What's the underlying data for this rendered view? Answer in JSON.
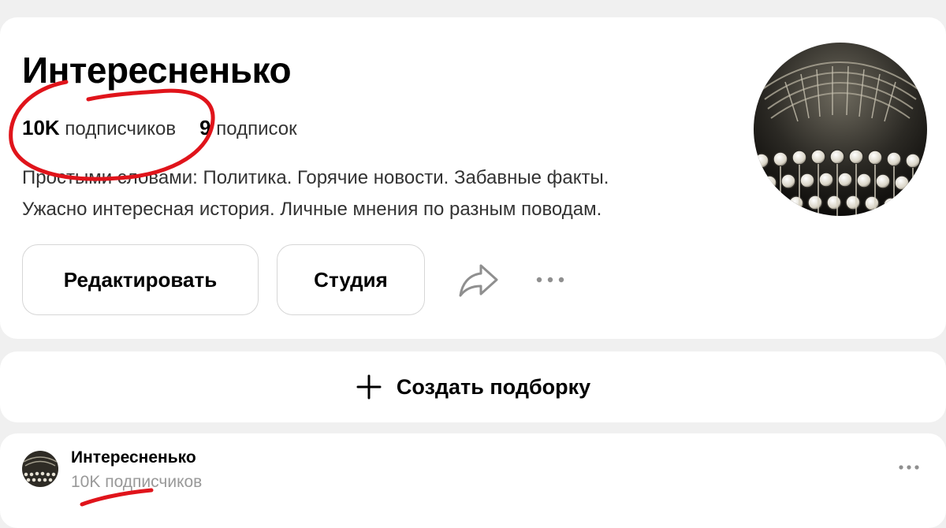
{
  "profile": {
    "title": "Интересненько",
    "followers_count": "10K",
    "followers_label": "подписчиков",
    "following_count": "9",
    "following_label": "подписок",
    "description_line1": "Простыми словами: Политика. Горячие новости. Забавные факты.",
    "description_line2": "Ужасно интересная история. Личные мнения по разным поводам.",
    "edit_button": "Редактировать",
    "studio_button": "Студия",
    "share_icon": "share-arrow-icon",
    "more_icon": "more-dots-icon",
    "avatar_image": "typewriter-keys"
  },
  "create_collection": {
    "label": "Создать подборку",
    "icon": "plus-icon"
  },
  "post": {
    "author": "Интересненько",
    "subscribers": "10K подписчиков",
    "more_icon": "more-dots-icon"
  },
  "colors": {
    "background": "#f0f0f0",
    "card": "#ffffff",
    "annotation": "#e0141b",
    "muted": "#999999"
  }
}
